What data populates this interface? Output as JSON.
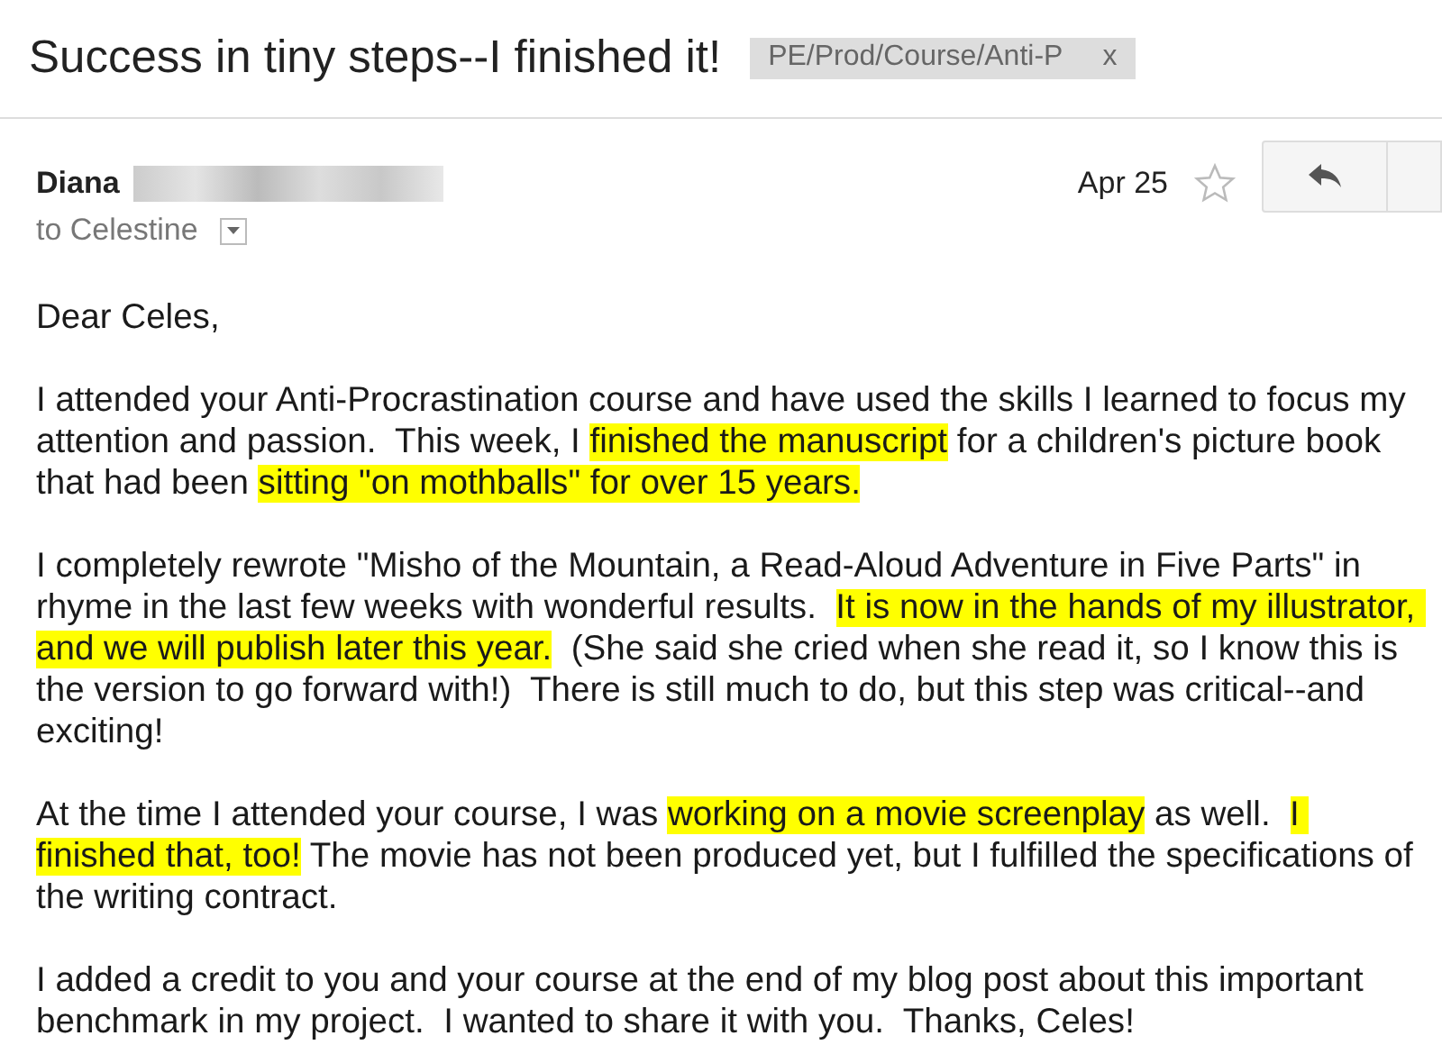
{
  "subject": "Success in tiny steps--I finished it!",
  "label": {
    "text": "PE/Prod/Course/Anti-P",
    "remove": "x"
  },
  "message": {
    "sender": "Diana",
    "date": "Apr 25",
    "starred": false,
    "recipient": "to Celestine",
    "body": [
      [
        {
          "text": "Dear Celes,",
          "highlighted": false
        }
      ],
      [
        {
          "text": "I attended your Anti-Procrastination course and have used the skills I learned to focus my attention and passion.  This week, I ",
          "highlighted": false
        },
        {
          "text": "finished the manuscript",
          "highlighted": true
        },
        {
          "text": " for a children's picture book that had been ",
          "highlighted": false
        },
        {
          "text": "sitting \"on mothballs\" for over 15 years.",
          "highlighted": true
        }
      ],
      [
        {
          "text": "I completely rewrote \"Misho of the Mountain, a Read-Aloud Adventure in Five Parts\" in rhyme in the last few weeks with wonderful results.  ",
          "highlighted": false
        },
        {
          "text": "It is now in the hands of my illustrator, and we will publish later this year.",
          "highlighted": true
        },
        {
          "text": "  (She said she cried when she read it, so I know this is the version to go forward with!)  There is still much to do, but this step was critical--and exciting!",
          "highlighted": false
        }
      ],
      [
        {
          "text": "At the time I attended your course, I was ",
          "highlighted": false
        },
        {
          "text": "working on a movie screenplay",
          "highlighted": true
        },
        {
          "text": " as well.  ",
          "highlighted": false
        },
        {
          "text": "I finished that, too!",
          "highlighted": true
        },
        {
          "text": " The movie has not been produced yet, but I fulfilled the specifications of the writing contract.",
          "highlighted": false
        }
      ],
      [
        {
          "text": "I added a credit to you and your course at the end of my blog post about this important benchmark in my project.  I wanted to share it with you.  Thanks, Celes!",
          "highlighted": false
        }
      ]
    ]
  }
}
